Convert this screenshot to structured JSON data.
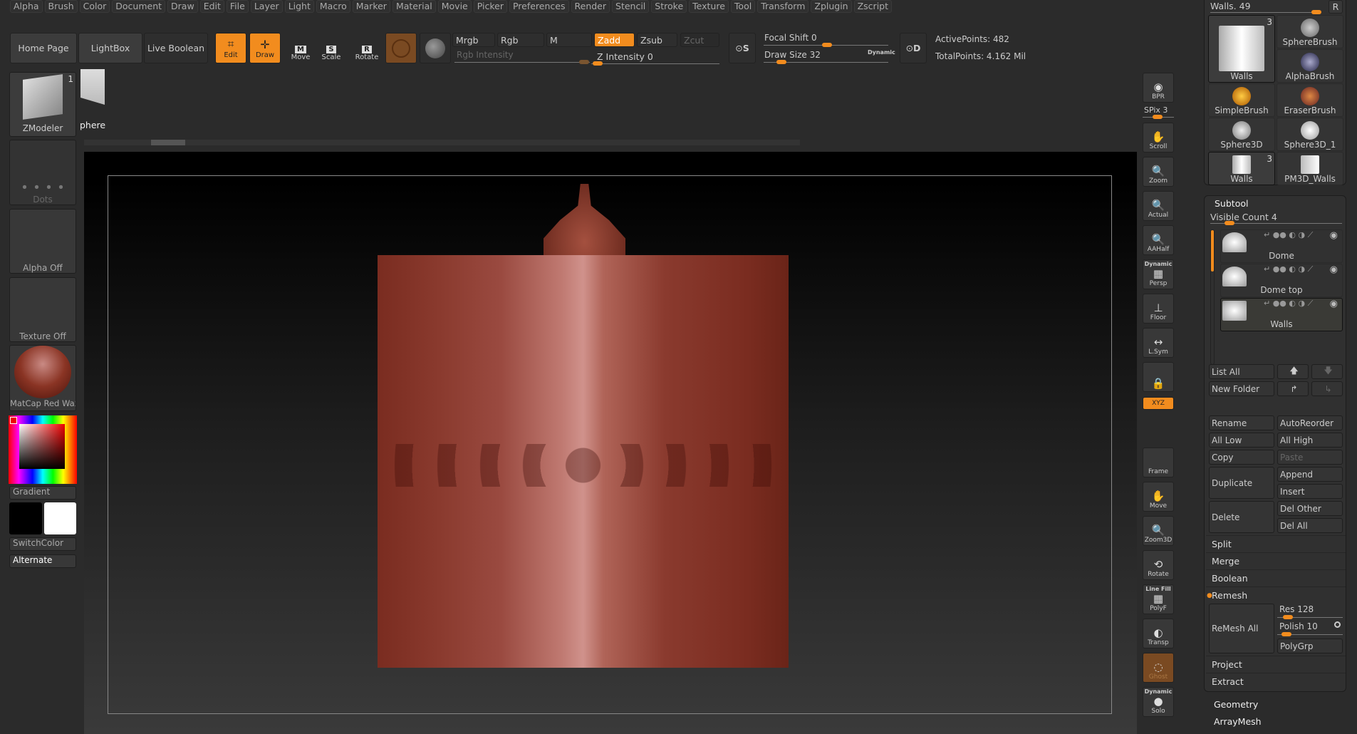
{
  "menu": [
    "Alpha",
    "Brush",
    "Color",
    "Document",
    "Draw",
    "Edit",
    "File",
    "Layer",
    "Light",
    "Macro",
    "Marker",
    "Material",
    "Movie",
    "Picker",
    "Preferences",
    "Render",
    "Stencil",
    "Stroke",
    "Texture",
    "Tool",
    "Transform",
    "Zplugin",
    "Zscript"
  ],
  "toolbar": {
    "home": "Home Page",
    "lightbox": "LightBox",
    "live_boolean": "Live Boolean",
    "edit": "Edit",
    "draw": "Draw",
    "move": "Move",
    "scale": "Scale",
    "rotate": "Rotate",
    "mrgb": "Mrgb",
    "rgb": "Rgb",
    "m": "M",
    "zadd": "Zadd",
    "zsub": "Zsub",
    "zcut": "Zcut",
    "rgb_intensity": "Rgb Intensity",
    "z_intensity": "Z Intensity 0",
    "focal_shift": "Focal Shift 0",
    "draw_size": "Draw Size 32",
    "dynamic": "Dynamic",
    "s_label": "S",
    "d_label": "D",
    "active_points": "ActivePoints: 482",
    "total_points": "TotalPoints: 4.162 Mil"
  },
  "left": {
    "brush": "ZModeler",
    "brush_count": "1",
    "tool_partial": "phere",
    "stroke": "Dots",
    "alpha": "Alpha Off",
    "texture": "Texture Off",
    "material": "MatCap Red Wax",
    "gradient": "Gradient",
    "switch_color": "SwitchColor",
    "alternate": "Alternate"
  },
  "right_tools": [
    {
      "icon": "◉",
      "label": "BPR"
    },
    {
      "icon": "✋",
      "label": "Scroll"
    },
    {
      "icon": "🔍",
      "label": "Zoom"
    },
    {
      "icon": "🔍",
      "label": "Actual"
    },
    {
      "icon": "🔍",
      "label": "AAHalf"
    },
    {
      "icon": "▦",
      "label": "Persp",
      "top": "Dynamic"
    },
    {
      "icon": "⊥",
      "label": "Floor"
    },
    {
      "icon": "↔",
      "label": "L.Sym"
    },
    {
      "icon": "🔒",
      "label": ""
    },
    {
      "icon": "",
      "label": "Frame"
    },
    {
      "icon": "✋",
      "label": "Move"
    },
    {
      "icon": "🔍",
      "label": "Zoom3D"
    },
    {
      "icon": "⟲",
      "label": "Rotate"
    },
    {
      "icon": "▦",
      "label": "PolyF",
      "top": "Line Fill"
    },
    {
      "icon": "◐",
      "label": "Transp"
    },
    {
      "icon": "◌",
      "label": "Ghost"
    },
    {
      "icon": "●",
      "label": "Solo",
      "top": "Dynamic"
    }
  ],
  "spix": "SPix 3",
  "xyz": "XYZ",
  "tool_panel": {
    "title": "Walls. 49",
    "r": "R",
    "brushes": [
      {
        "label": "Walls",
        "count": "3"
      },
      {
        "label": "SphereBrush"
      },
      {
        "label": "AlphaBrush"
      },
      {
        "label": "SimpleBrush"
      },
      {
        "label": "EraserBrush"
      },
      {
        "label": "Sphere3D"
      },
      {
        "label": "Sphere3D_1"
      },
      {
        "label": "Walls",
        "count": "3"
      },
      {
        "label": "PM3D_Walls"
      }
    ]
  },
  "subtool": {
    "title": "Subtool",
    "visible_count": "Visible Count 4",
    "items": [
      "Dome",
      "Dome top",
      "Walls"
    ],
    "list_all": "List All",
    "new_folder": "New Folder",
    "rename": "Rename",
    "autoreorder": "AutoReorder",
    "all_low": "All Low",
    "all_high": "All High",
    "copy": "Copy",
    "paste": "Paste",
    "duplicate": "Duplicate",
    "append": "Append",
    "insert": "Insert",
    "delete": "Delete",
    "del_other": "Del Other",
    "del_all": "Del All",
    "split": "Split",
    "merge": "Merge",
    "boolean": "Boolean",
    "remesh": "Remesh",
    "remesh_all": "ReMesh All",
    "res": "Res 128",
    "polish": "Polish 10",
    "polygrp": "PolyGrp",
    "project": "Project",
    "extract": "Extract"
  },
  "sections": [
    "Geometry",
    "ArrayMesh"
  ],
  "colors": {
    "accent": "#f28c1e",
    "object": "#8a3a2e"
  }
}
